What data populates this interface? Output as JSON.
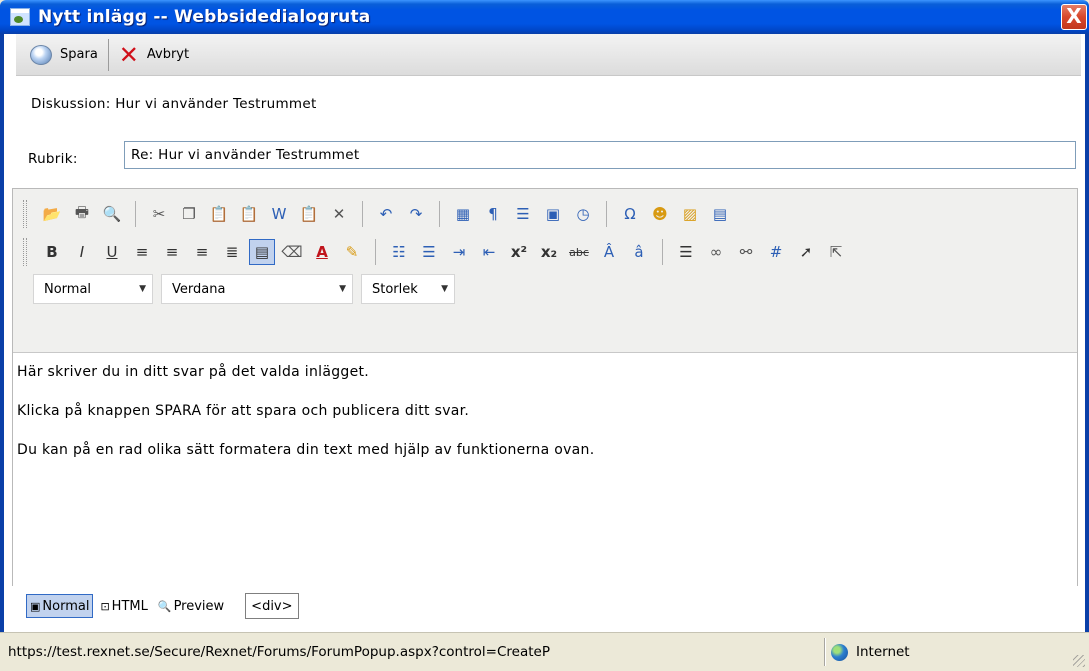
{
  "window": {
    "title": "Nytt inlägg -- Webbsidedialogruta",
    "close_glyph": "X"
  },
  "actions": {
    "save_label": "Spara",
    "cancel_label": "Avbryt"
  },
  "form": {
    "discussion_label": "Diskussion:",
    "discussion_value": "Hur vi använder Testrummet",
    "subject_label": "Rubrik:",
    "subject_value": "Re: Hur vi använder Testrummet"
  },
  "editor": {
    "toolbar_row1": [
      "open-icon",
      "print-icon",
      "find-icon",
      "cut-icon",
      "copy-icon",
      "paste-icon",
      "paste-text-icon",
      "paste-word-icon",
      "paste-html-icon",
      "delete-icon",
      "undo-icon",
      "redo-icon",
      "spellcheck-icon",
      "insert-paragraph-icon",
      "insert-rule-icon",
      "insert-date-icon",
      "insert-time-icon",
      "symbol-icon",
      "smiley-icon",
      "image-icon",
      "table-icon"
    ],
    "toolbar_row2": [
      "bold-icon",
      "italic-icon",
      "underline-icon",
      "align-left-icon",
      "align-center-icon",
      "align-right-icon",
      "justify-icon",
      "justify-full-icon",
      "remove-format-icon",
      "text-color-icon",
      "highlight-icon",
      "numbered-list-icon",
      "bulleted-list-icon",
      "indent-icon",
      "outdent-icon",
      "superscript-icon",
      "subscript-icon",
      "strikethrough-icon",
      "uppercase-icon",
      "lowercase-icon",
      "horizontal-rule-icon",
      "link-icon",
      "unlink-icon",
      "grid-icon",
      "select-all-icon",
      "pointer-icon"
    ],
    "format_select": "Normal",
    "font_select": "Verdana",
    "size_select": "Storlek",
    "content": [
      "Här skriver du in ditt svar på det valda inlägget.",
      "Klicka på knappen SPARA för att spara och publicera ditt svar.",
      "Du kan på en rad olika sätt formatera din text med hjälp av funktionerna ovan."
    ],
    "modes": {
      "normal": "Normal",
      "html": "HTML",
      "preview": "Preview"
    },
    "tag_path": "<div>"
  },
  "status": {
    "url": "https://test.rexnet.se/Secure/Rexnet/Forums/ForumPopup.aspx?control=CreateP",
    "zone": "Internet"
  },
  "colors": {
    "titlebar": "#0054e3",
    "close_button": "#d8472c",
    "active_button": "#c1d2ee"
  }
}
